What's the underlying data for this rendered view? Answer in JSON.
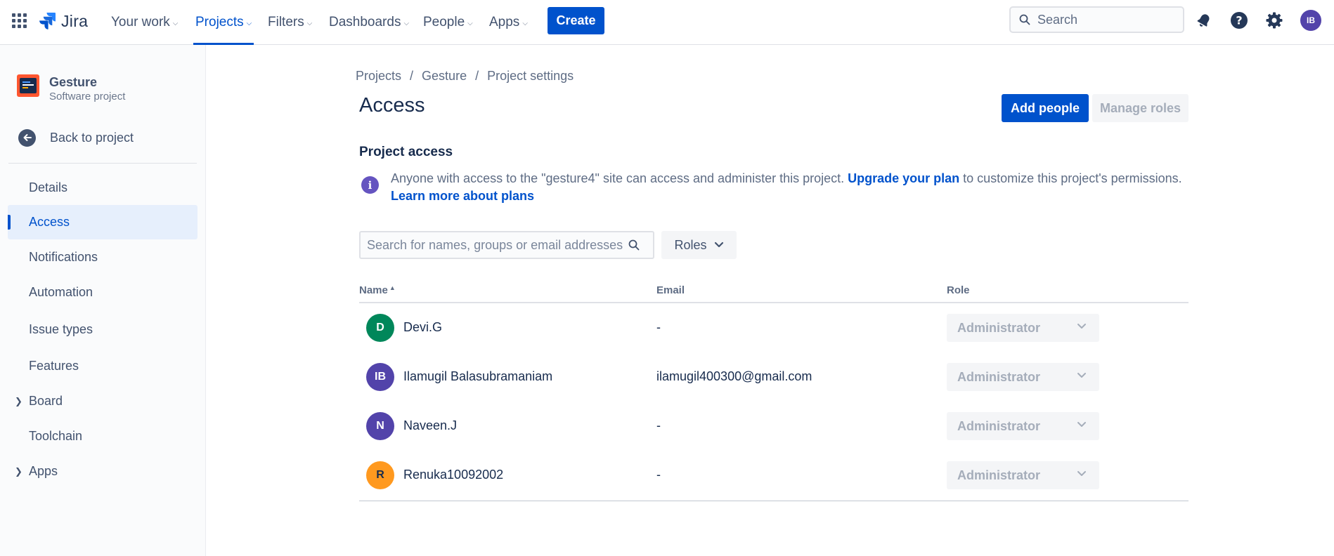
{
  "topnav": {
    "logo_text": "Jira",
    "items": [
      {
        "label": "Your work"
      },
      {
        "label": "Projects"
      },
      {
        "label": "Filters"
      },
      {
        "label": "Dashboards"
      },
      {
        "label": "People"
      },
      {
        "label": "Apps"
      }
    ],
    "active_item": "Projects",
    "create_label": "Create",
    "search_placeholder": "Search",
    "user_initials": "IB"
  },
  "sidebar": {
    "project_name": "Gesture",
    "project_type": "Software project",
    "back_label": "Back to project",
    "items": [
      {
        "label": "Details"
      },
      {
        "label": "Access"
      },
      {
        "label": "Notifications"
      },
      {
        "label": "Automation"
      },
      {
        "label": "Issue types"
      },
      {
        "label": "Features"
      },
      {
        "label": "Board"
      },
      {
        "label": "Toolchain"
      },
      {
        "label": "Apps"
      }
    ],
    "selected_item": "Access"
  },
  "main": {
    "breadcrumb": [
      "Projects",
      "Gesture",
      "Project settings"
    ],
    "breadcrumb_separator": "/",
    "title": "Access",
    "add_people_label": "Add people",
    "manage_roles_label": "Manage roles",
    "section_title": "Project access",
    "info": {
      "text_before": "Anyone with access to the \"gesture4\" site can access and administer this project. ",
      "upgrade_link": "Upgrade your plan",
      "text_after": " to customize this project's permissions.",
      "learn_link": "Learn more about plans"
    },
    "search_placeholder": "Search for names, groups or email addresses",
    "roles_filter_label": "Roles",
    "table": {
      "headers": {
        "name": "Name",
        "email": "Email",
        "role": "Role"
      },
      "rows": [
        {
          "initials": "D",
          "name": "Devi.G",
          "email": "-",
          "role": "Administrator",
          "avatar_color": "#00875a"
        },
        {
          "initials": "IB",
          "name": "Ilamugil Balasubramaniam",
          "email": "ilamugil400300@gmail.com",
          "role": "Administrator",
          "avatar_color": "#5243aa"
        },
        {
          "initials": "N",
          "name": "Naveen.J",
          "email": "-",
          "role": "Administrator",
          "avatar_color": "#5243aa"
        },
        {
          "initials": "R",
          "name": "Renuka10092002",
          "email": "-",
          "role": "Administrator",
          "avatar_color": "#ff991f"
        }
      ]
    }
  },
  "colors": {
    "brand": "#0052cc",
    "text": "#172b4d",
    "subtle": "#5e6c84",
    "info_purple": "#6554c0"
  }
}
